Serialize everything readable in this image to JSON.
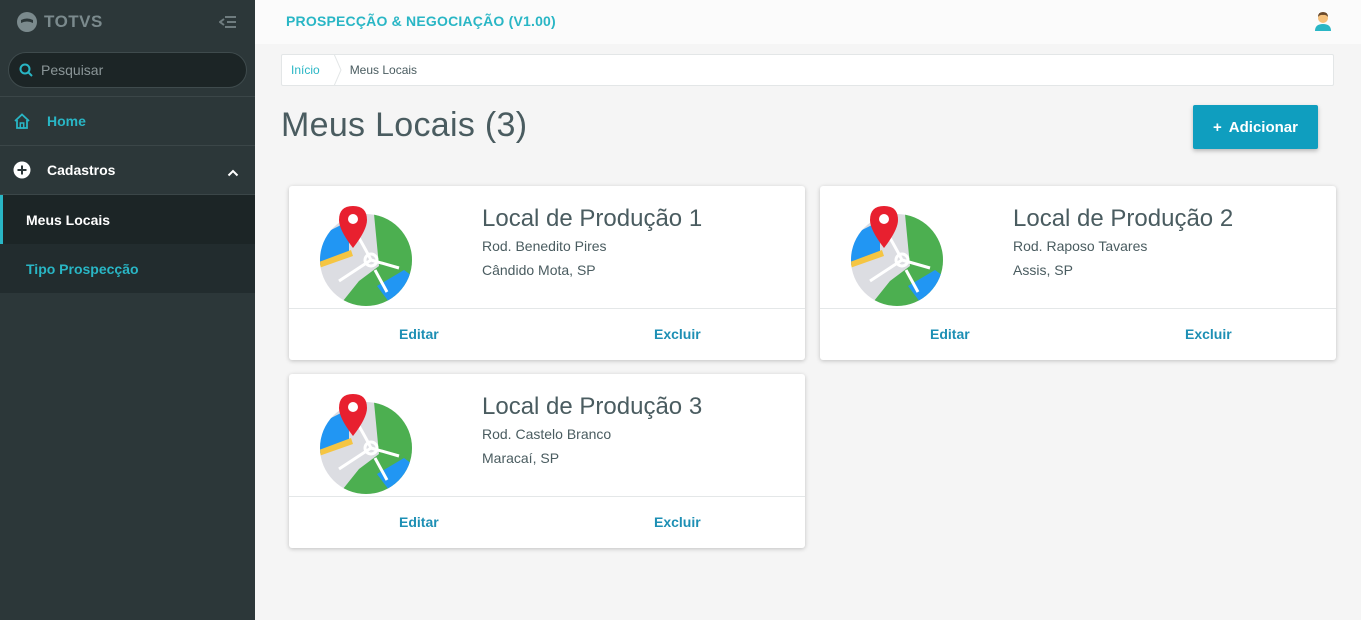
{
  "brand": {
    "name": "TOTVS"
  },
  "search": {
    "placeholder": "Pesquisar"
  },
  "sidebar": {
    "items": [
      {
        "label": "Home",
        "icon": "home-icon"
      },
      {
        "label": "Cadastros",
        "icon": "plus-circle-icon"
      }
    ],
    "sub_items": [
      {
        "label": "Meus Locais",
        "active": true
      },
      {
        "label": "Tipo Prospecção",
        "active": false
      }
    ]
  },
  "header": {
    "app_title": "PROSPECÇÃO & NEGOCIAÇÃO (V1.00)"
  },
  "breadcrumb": {
    "home": "Início",
    "current": "Meus Locais"
  },
  "page": {
    "title": "Meus Locais (3)",
    "add_label": "Adicionar",
    "add_symbol": "+"
  },
  "cards": [
    {
      "title": "Local de Produção 1",
      "address": "Rod. Benedito Pires",
      "city": "Cândido Mota, SP",
      "edit": "Editar",
      "delete": "Excluir"
    },
    {
      "title": "Local de Produção 2",
      "address": "Rod. Raposo Tavares",
      "city": "Assis, SP",
      "edit": "Editar",
      "delete": "Excluir"
    },
    {
      "title": "Local de Produção 3",
      "address": "Rod. Castelo Branco",
      "city": "Maracaí, SP",
      "edit": "Editar",
      "delete": "Excluir"
    }
  ],
  "colors": {
    "accent": "#29b6c5",
    "button": "#0f9ebf",
    "sidebar": "#2c3739",
    "link": "#1d8fb4"
  }
}
